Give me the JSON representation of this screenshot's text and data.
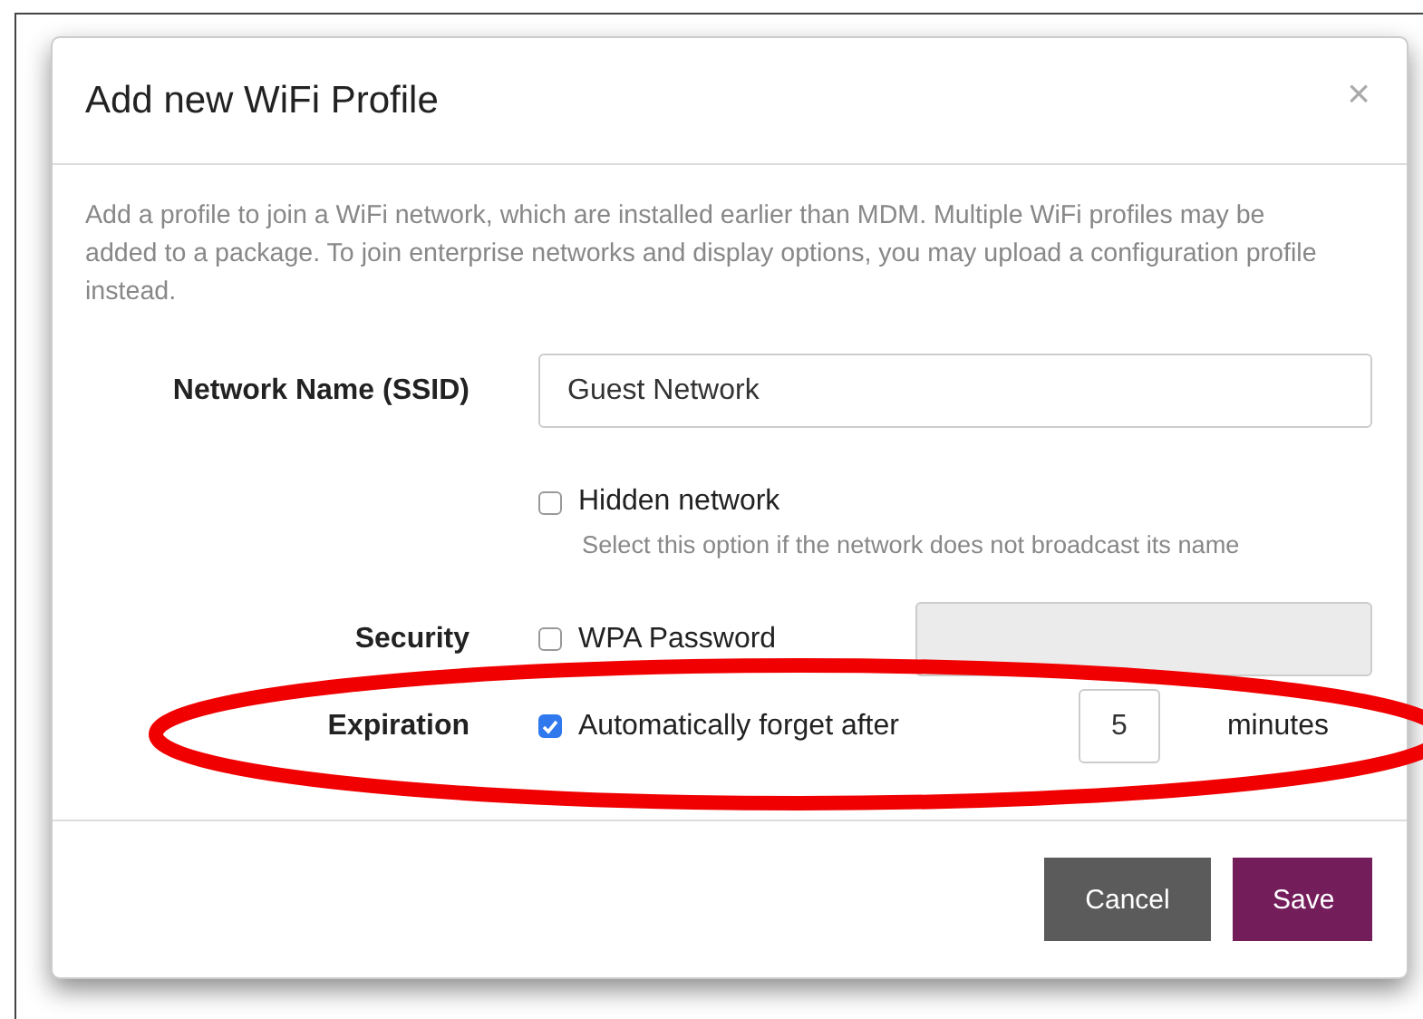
{
  "dialog": {
    "title": "Add new WiFi Profile",
    "close": "×",
    "description": "Add a profile to join a WiFi network, which are installed earlier than MDM. Multiple WiFi profiles may be added to a package. To join enterprise networks and display options, you may upload a configuration profile instead.",
    "rows": [
      {
        "kind": "text",
        "label": "Network Name (SSID)",
        "value": "Guest Network"
      },
      {
        "kind": "checkbox",
        "option": "Hidden network",
        "checked": false,
        "hint": "Select this option if the network does not broadcast its name"
      },
      {
        "kind": "password",
        "label": "Security",
        "option": "WPA Password",
        "checked": false,
        "disabled": true
      },
      {
        "kind": "number",
        "label": "Expiration",
        "option": "Automatically forget after",
        "checked": true,
        "value": "5",
        "unit": "minutes"
      }
    ],
    "buttons": [
      {
        "label": "Cancel",
        "kind": "secondary"
      },
      {
        "label": "Save",
        "kind": "primary"
      }
    ]
  },
  "highlight": {
    "kind": "ellipse"
  }
}
